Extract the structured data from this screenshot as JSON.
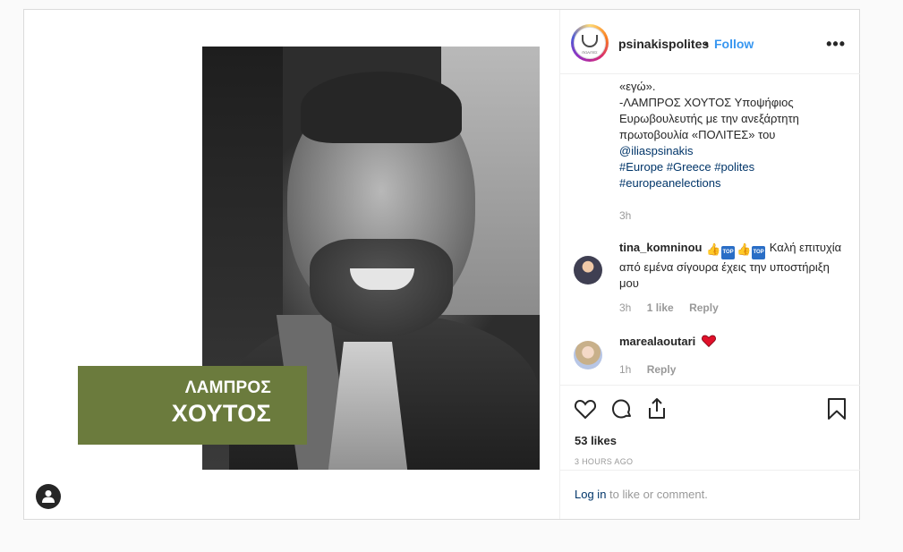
{
  "post": {
    "overlay": {
      "line1": "ΛΑΜΠΡΟΣ",
      "line2": "ΧΟΥΤΟΣ"
    }
  },
  "header": {
    "username": "psinakispolites",
    "separator": "•",
    "follow_label": "Follow",
    "more_label": "•••",
    "avatar_text": "ΠΟΛΙΤΕΣ"
  },
  "caption": {
    "line1": "«εγώ».",
    "line2": "-ΛΑΜΠΡΟΣ ΧΟΥΤΟΣ Υποψήφιος",
    "line3": "Ευρωβουλευτής με την ανεξάρτητη",
    "line4": "πρωτοβουλία «ΠΟΛΙΤΕΣ» του",
    "mention": "@iliaspsinakis",
    "tag1": "#Europe",
    "tag2": "#Greece",
    "tag3": "#polites",
    "tag4": "#europeanelections",
    "time": "3h"
  },
  "comments": [
    {
      "username": "tina_komninou",
      "text": "Καλή επιτυχία από εμένα σίγουρα έχεις την υποστήριξη μου",
      "time": "3h",
      "likes": "1 like",
      "reply": "Reply",
      "top_label": "TOP"
    },
    {
      "username": "marealaoutari",
      "time": "1h",
      "reply": "Reply"
    }
  ],
  "actions": {
    "likes": "53 likes",
    "timestamp": "3 HOURS AGO"
  },
  "login": {
    "link": "Log in",
    "rest": " to like or comment."
  }
}
